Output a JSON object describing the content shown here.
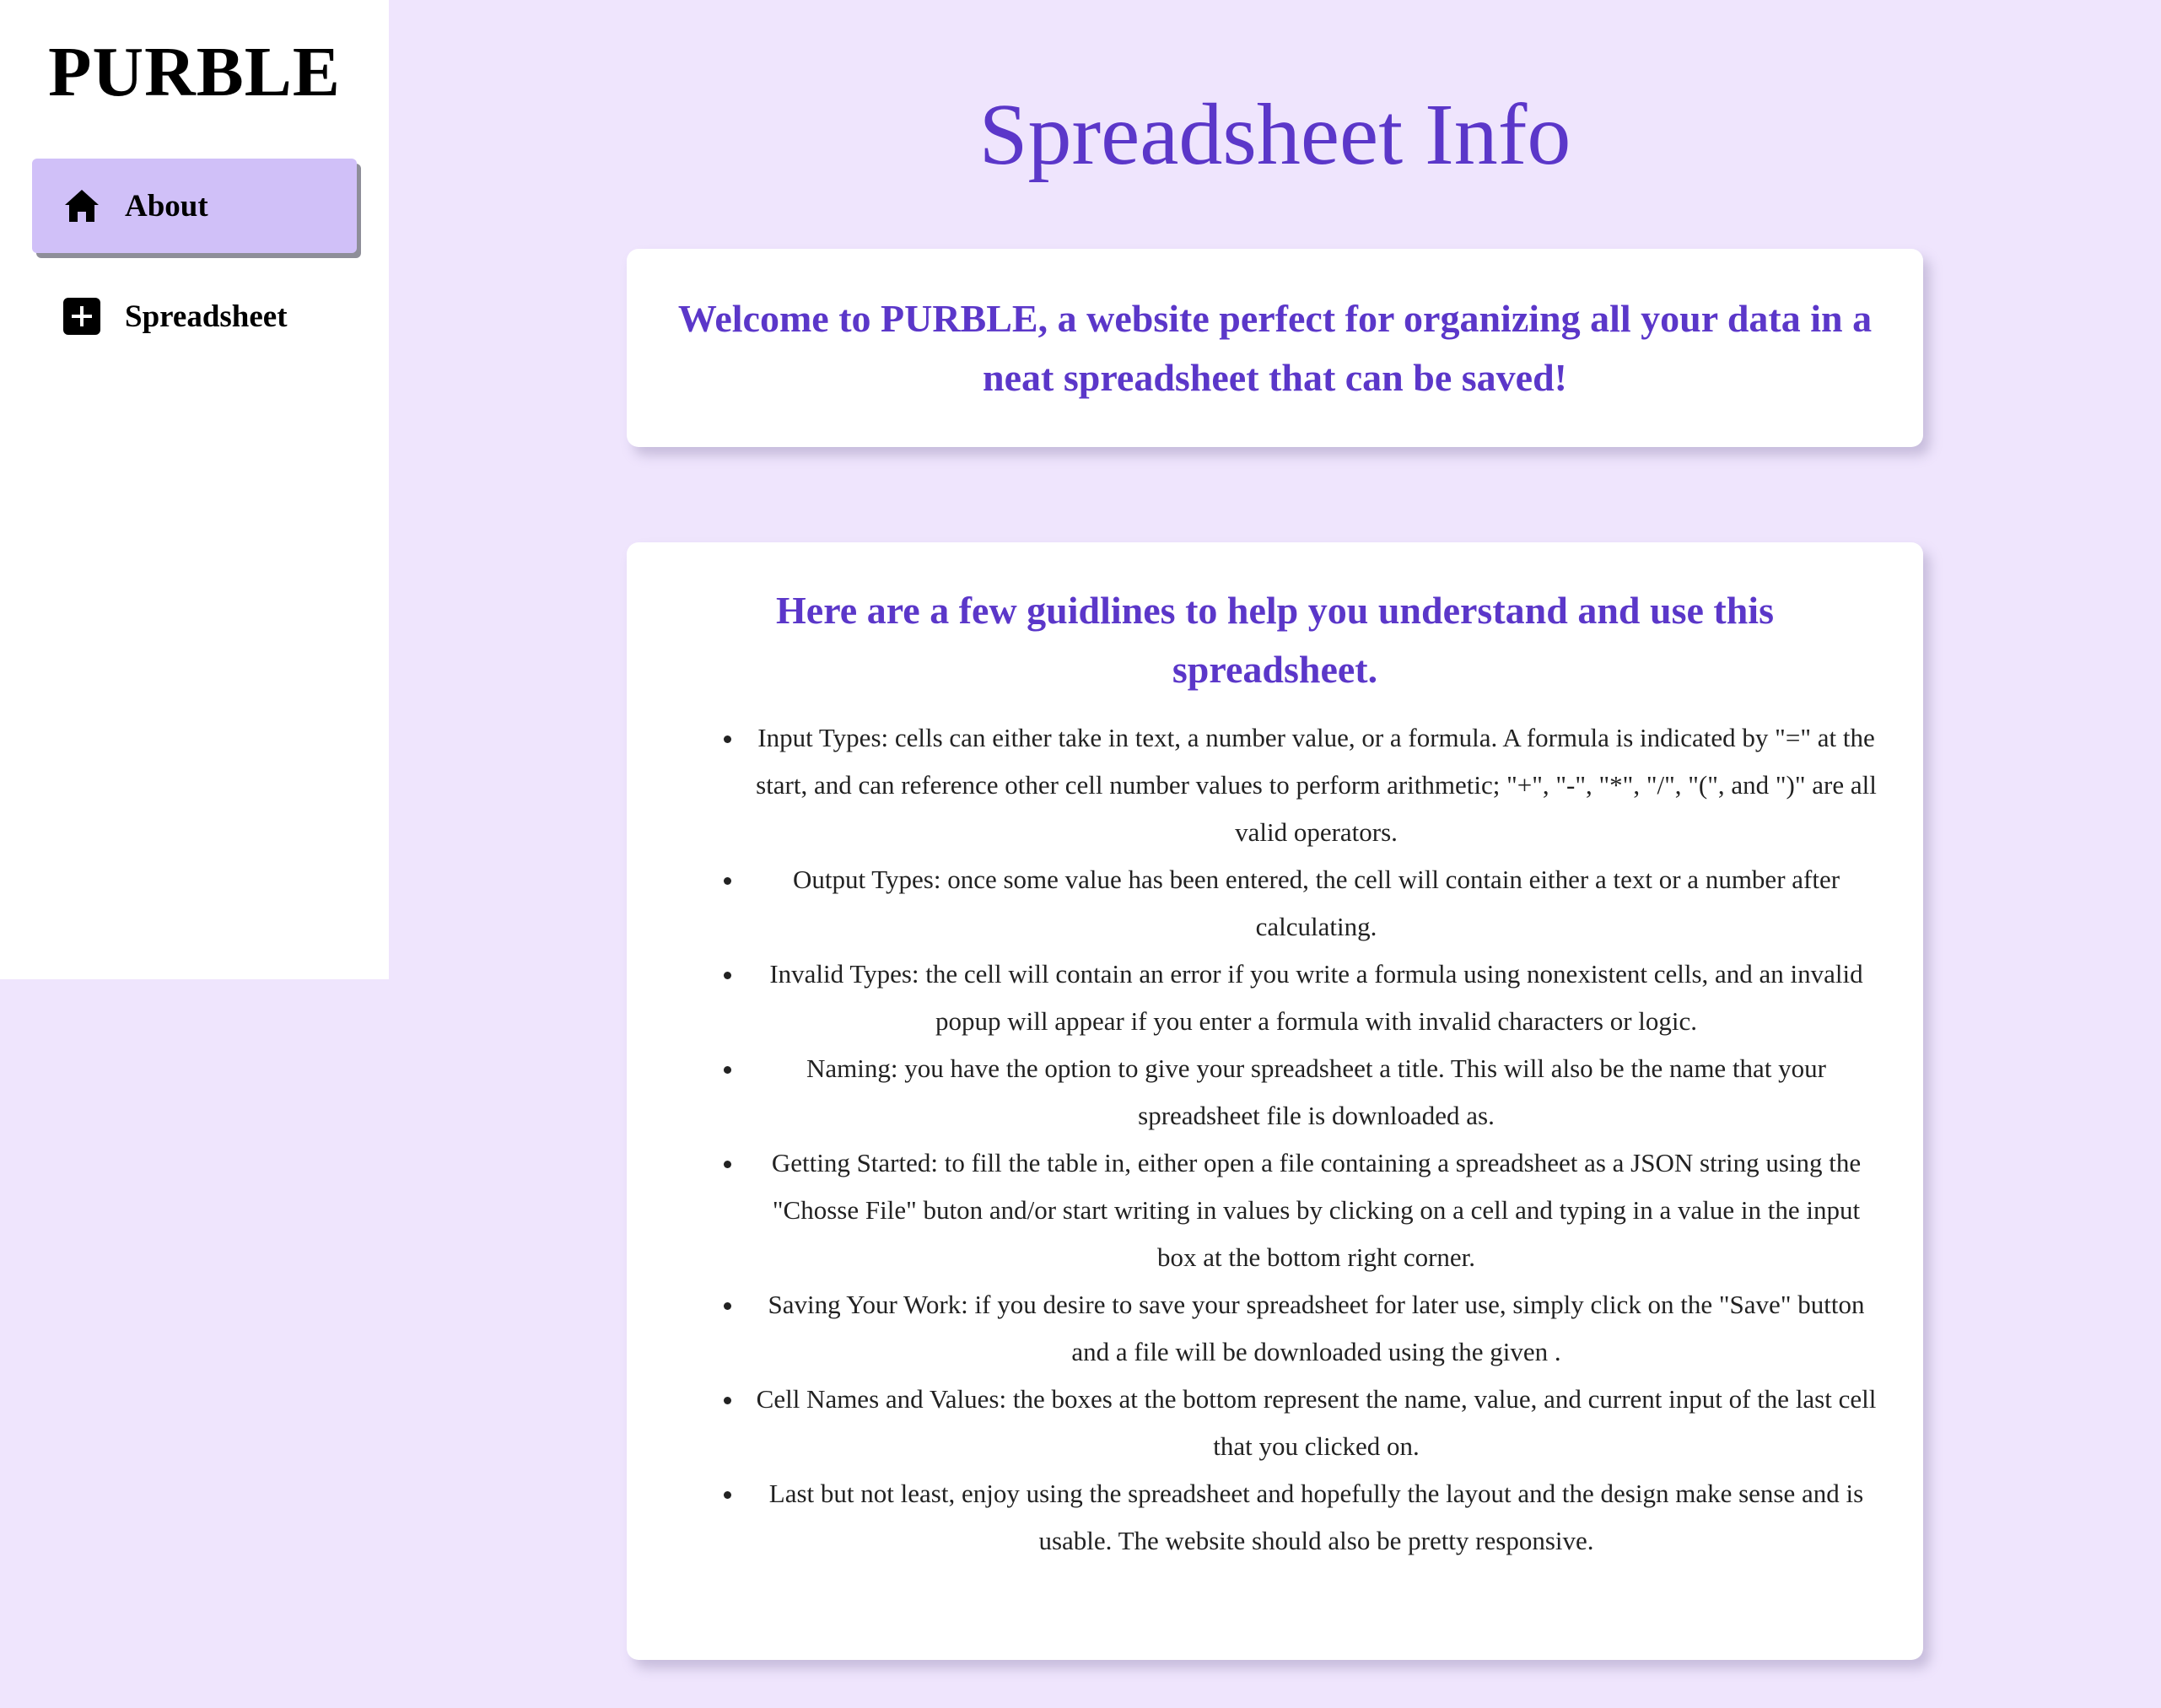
{
  "sidebar": {
    "logo": "PURBLE",
    "items": [
      {
        "label": "About",
        "icon": "home-icon",
        "active": true
      },
      {
        "label": "Spreadsheet",
        "icon": "plus-icon",
        "active": false
      }
    ]
  },
  "main": {
    "title": "Spreadsheet Info",
    "welcome": "Welcome to PURBLE, a website perfect for organizing all your data in a neat spreadsheet that can be saved!",
    "guide_heading": "Here are a few guidlines to help you understand and use this spreadsheet.",
    "guidelines": [
      "Input Types: cells can either take in text, a number value, or a formula. A formula is indicated by \"=\" at the start, and can reference other cell number values to perform arithmetic; \"+\", \"-\", \"*\", \"/\", \"(\", and \")\" are all valid operators.",
      "Output Types: once some value has been entered, the cell will contain either a text or a number after calculating.",
      "Invalid Types: the cell will contain an error if you write a formula using nonexistent cells, and an invalid popup will appear if you enter a formula with invalid characters or logic.",
      "Naming: you have the option to give your spreadsheet a title. This will also be the name that your spreadsheet file is downloaded as.",
      "Getting Started: to fill the table in, either open a file containing a spreadsheet as a JSON string using the \"Chosse File\" buton and/or start writing in values by clicking on a cell and typing in a value in the input box at the bottom right corner.",
      "Saving Your Work: if you desire to save your spreadsheet for later use, simply click on the \"Save\" button and a file will be downloaded using the given .",
      "Cell Names and Values: the boxes at the bottom represent the name, value, and current input of the last cell that you clicked on.",
      "Last but not least, enjoy using the spreadsheet and hopefully the layout and the design make sense and is usable. The website should also be pretty responsive."
    ]
  },
  "colors": {
    "background": "#efe5fd",
    "accent": "#5b37c9",
    "active_nav": "#d0c0f8"
  }
}
